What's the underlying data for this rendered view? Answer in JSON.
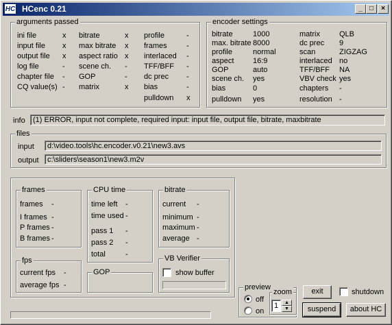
{
  "window": {
    "icon_text": "HC",
    "title": "HCenc 0.21",
    "minimize": "_",
    "maximize": "□",
    "close": "×"
  },
  "args": {
    "title": "arguments passed",
    "col1": [
      {
        "label": "ini file",
        "value": "x"
      },
      {
        "label": "input file",
        "value": "x"
      },
      {
        "label": "output file",
        "value": "x"
      },
      {
        "label": "log file",
        "value": "-"
      },
      {
        "label": "chapter file",
        "value": "-"
      },
      {
        "label": "CQ value(s)",
        "value": "-"
      }
    ],
    "col2": [
      {
        "label": "bitrate",
        "value": "x"
      },
      {
        "label": "max bitrate",
        "value": "x"
      },
      {
        "label": "aspect ratio",
        "value": "x"
      },
      {
        "label": "scene ch.",
        "value": "-"
      },
      {
        "label": "GOP",
        "value": "-"
      },
      {
        "label": "matrix",
        "value": "x"
      }
    ],
    "col3": [
      {
        "label": "profile",
        "value": "-"
      },
      {
        "label": "frames",
        "value": "-"
      },
      {
        "label": "interlaced",
        "value": "-"
      },
      {
        "label": "TFF/BFF",
        "value": "-"
      },
      {
        "label": "dc prec",
        "value": "-"
      },
      {
        "label": "bias",
        "value": "-"
      },
      {
        "label": "pulldown",
        "value": "x"
      }
    ]
  },
  "encoder": {
    "title": "encoder settings",
    "left": [
      {
        "label": "bitrate",
        "value": "1000"
      },
      {
        "label": "max. bitrate",
        "value": "8000"
      },
      {
        "label": "profile",
        "value": "normal"
      },
      {
        "label": "aspect",
        "value": "16:9"
      },
      {
        "label": "GOP",
        "value": "auto"
      },
      {
        "label": "scene ch.",
        "value": "yes"
      },
      {
        "label": "bias",
        "value": "0"
      },
      {
        "label": "pulldown",
        "value": "yes"
      }
    ],
    "right": [
      {
        "label": "matrix",
        "value": "QLB"
      },
      {
        "label": "dc prec",
        "value": "9"
      },
      {
        "label": "scan",
        "value": "ZIGZAG"
      },
      {
        "label": "interlaced",
        "value": "no"
      },
      {
        "label": "TFF/BFF",
        "value": "NA"
      },
      {
        "label": "VBV check",
        "value": "yes"
      },
      {
        "label": "chapters",
        "value": "-"
      },
      {
        "label": "resolution",
        "value": "-"
      }
    ]
  },
  "info": {
    "label": "info",
    "text": "(1) ERROR, input not complete, required input: input file, output file, bitrate, maxbitrate"
  },
  "files": {
    "title": "files",
    "input_label": "input",
    "input_value": "d:\\video.tools\\hc.encoder.v0.21\\new3.avs",
    "output_label": "output",
    "output_value": "c:\\sliders\\season1\\new3.m2v"
  },
  "frames": {
    "title": "frames",
    "rows": [
      {
        "label": "frames",
        "value": "-"
      },
      {
        "label": "I frames",
        "value": "-"
      },
      {
        "label": "P frames",
        "value": "-"
      },
      {
        "label": "B frames",
        "value": "-"
      }
    ]
  },
  "fps": {
    "title": "fps",
    "rows": [
      {
        "label": "current fps",
        "value": "-"
      },
      {
        "label": "average fps",
        "value": "-"
      }
    ]
  },
  "cpu": {
    "title": "CPU time",
    "rows": [
      {
        "label": "time left",
        "value": "-"
      },
      {
        "label": "time used",
        "value": "-"
      },
      {
        "label": "pass 1",
        "value": "-"
      },
      {
        "label": "pass 2",
        "value": "-"
      },
      {
        "label": "total",
        "value": "-"
      }
    ]
  },
  "gop": {
    "title": "GOP"
  },
  "bitrate": {
    "title": "bitrate",
    "rows": [
      {
        "label": "current",
        "value": "-"
      },
      {
        "label": "minimum",
        "value": "-"
      },
      {
        "label": "maximum",
        "value": "-"
      },
      {
        "label": "average",
        "value": "-"
      }
    ]
  },
  "vbv": {
    "title": "VB Verifier",
    "show_buffer": "show buffer",
    "buffer_level": 0
  },
  "preview": {
    "title": "preview",
    "off": "off",
    "on": "on",
    "zoom_label": "zoom",
    "zoom_value": "1",
    "selected": "off"
  },
  "buttons": {
    "exit": "exit",
    "shutdown": "shutdown",
    "suspend": "suspend",
    "about": "about  HC"
  },
  "status": {
    "progress": 0
  }
}
